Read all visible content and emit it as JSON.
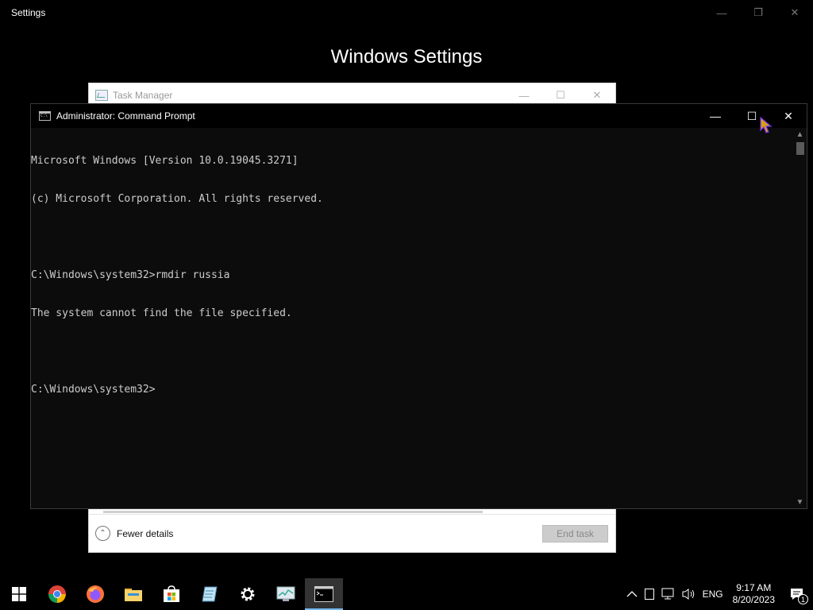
{
  "settings": {
    "title": "Settings",
    "heading": "Windows Settings"
  },
  "task_manager": {
    "title": "Task Manager",
    "fewer_details": "Fewer details",
    "end_task": "End task"
  },
  "cmd": {
    "title": "Administrator: Command Prompt",
    "lines": [
      "Microsoft Windows [Version 10.0.19045.3271]",
      "(c) Microsoft Corporation. All rights reserved.",
      "",
      "C:\\Windows\\system32>rmdir russia",
      "The system cannot find the file specified.",
      "",
      "C:\\Windows\\system32>"
    ]
  },
  "taskbar": {
    "apps": [
      "start-icon",
      "chrome-icon",
      "firefox-icon",
      "file-explorer-icon",
      "store-icon",
      "notepad-icon",
      "settings-gear-icon",
      "task-manager-icon",
      "command-prompt-icon"
    ],
    "language": "ENG",
    "time": "9:17 AM",
    "date": "8/20/2023",
    "notification_count": "1"
  },
  "colors": {
    "accent": "#76b9ed",
    "console_bg": "#0c0c0c",
    "console_text": "#cccccc"
  }
}
